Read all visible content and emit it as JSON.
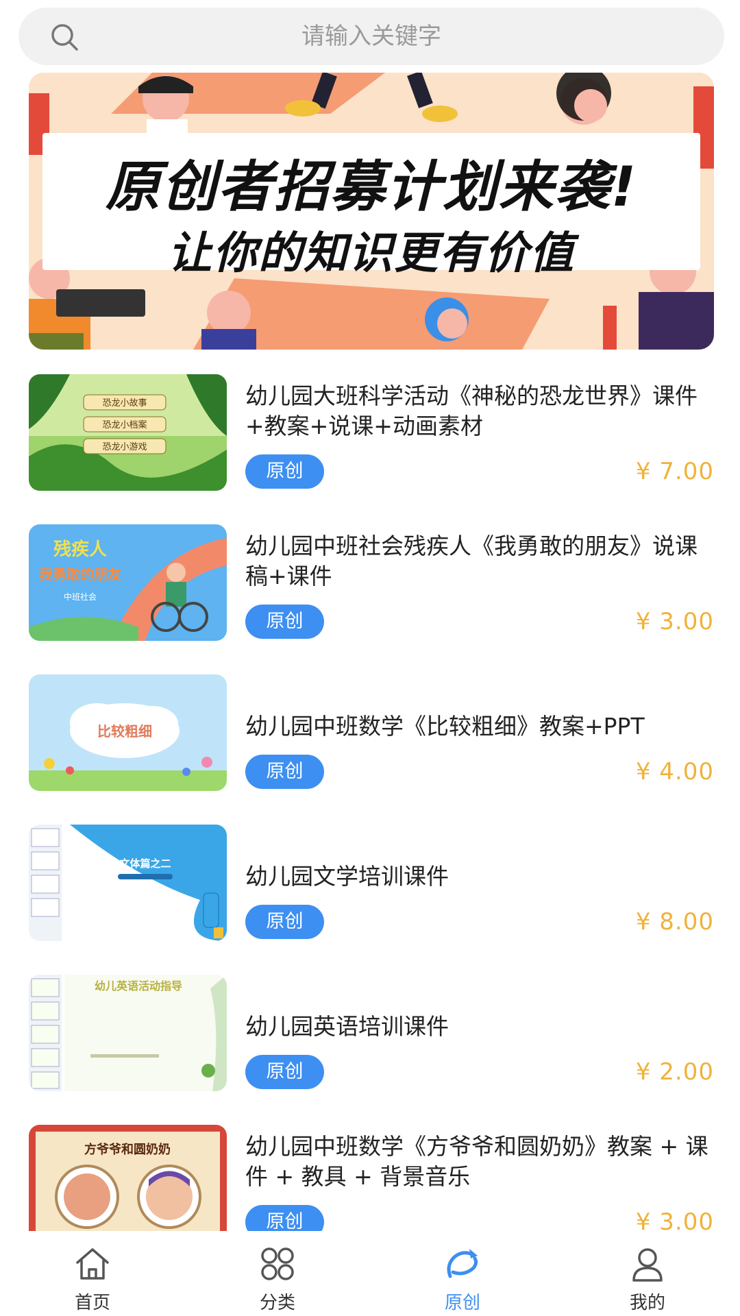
{
  "search": {
    "placeholder": "请输入关键字"
  },
  "banner": {
    "title": "原创者招募计划来袭!",
    "subtitle": "让你的知识更有价值"
  },
  "items": [
    {
      "title": "幼儿园大班科学活动《神秘的恐龙世界》课件+教案+说课+动画素材",
      "badge": "原创",
      "price": "¥ 7.00",
      "thumb_text": [
        "恐龙小故事",
        "恐龙小档案",
        "恐龙小游戏"
      ]
    },
    {
      "title": "幼儿园中班社会残疾人《我勇敢的朋友》说课稿+课件",
      "badge": "原创",
      "price": "¥ 3.00",
      "thumb_text": [
        "残疾人",
        "我勇敢的朋友",
        "中班社会"
      ]
    },
    {
      "title": "幼儿园中班数学《比较粗细》教案+PPT",
      "badge": "原创",
      "price": "¥ 4.00",
      "thumb_text": [
        "比较粗细"
      ]
    },
    {
      "title": "幼儿园文学培训课件",
      "badge": "原创",
      "price": "¥ 8.00",
      "thumb_text": [
        "文体篇之二"
      ]
    },
    {
      "title": "幼儿园英语培训课件",
      "badge": "原创",
      "price": "¥ 2.00",
      "thumb_text": [
        "幼儿英语活动指导"
      ]
    },
    {
      "title": "幼儿园中班数学《方爷爷和圆奶奶》教案 + 课件 + 教具 + 背景音乐",
      "badge": "原创",
      "price": "¥ 3.00",
      "thumb_text": [
        "方爷爷和圆奶奶"
      ]
    }
  ],
  "nav": [
    {
      "label": "首页",
      "icon": "home-icon"
    },
    {
      "label": "分类",
      "icon": "category-icon"
    },
    {
      "label": "原创",
      "icon": "original-icon",
      "active": true
    },
    {
      "label": "我的",
      "icon": "user-icon"
    }
  ],
  "colors": {
    "accent": "#3d8ff1",
    "price": "#f0b23a",
    "search_bg": "#f1f1f1"
  }
}
